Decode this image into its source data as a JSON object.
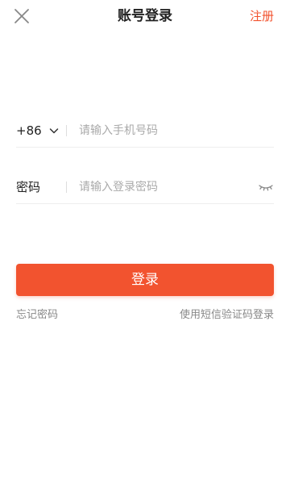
{
  "header": {
    "title": "账号登录",
    "register_label": "注册",
    "close_icon": "close-icon"
  },
  "phone_row": {
    "country_code": "+86",
    "dropdown_icon": "chevron-down-icon",
    "placeholder": "请输入手机号码",
    "value": ""
  },
  "password_row": {
    "label": "密码",
    "placeholder": "请输入登录密码",
    "value": "",
    "toggle_icon": "eye-closed-icon"
  },
  "login_button": {
    "label": "登录"
  },
  "links": {
    "forgot_password": "忘记密码",
    "sms_login": "使用短信验证码登录"
  },
  "colors": {
    "accent": "#f2532f",
    "text_primary": "#222222",
    "text_secondary": "#888888",
    "placeholder": "#aaaaaa",
    "divider": "#eeeeee"
  }
}
